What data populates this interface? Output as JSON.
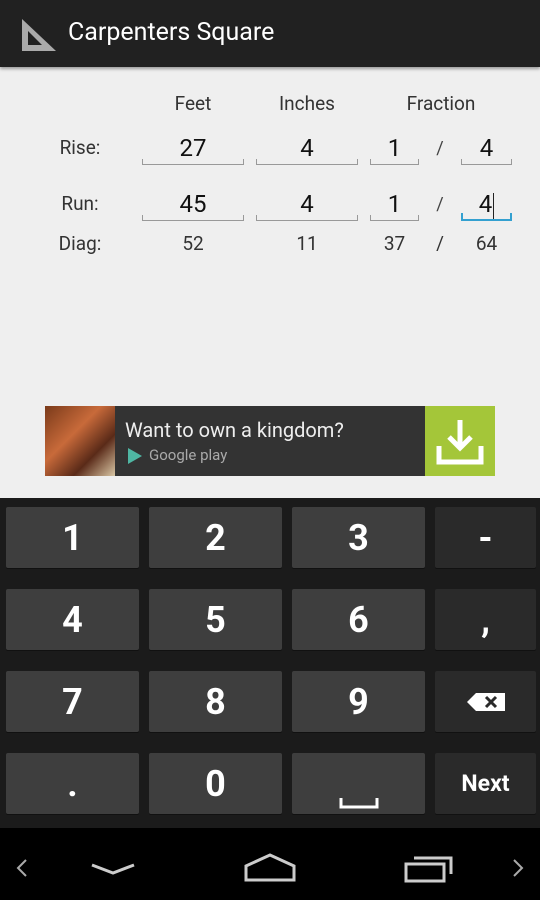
{
  "app": {
    "title": "Carpenters Square",
    "icon": "set-square-icon"
  },
  "columns": {
    "feet": "Feet",
    "inches": "Inches",
    "fraction": "Fraction"
  },
  "rows": {
    "rise": {
      "label": "Rise:",
      "feet": "27",
      "inches": "4",
      "num": "1",
      "den": "4"
    },
    "run": {
      "label": "Run:",
      "feet": "45",
      "inches": "4",
      "num": "1",
      "den": "4"
    },
    "diag": {
      "label": "Diag:",
      "feet": "52",
      "inches": "11",
      "num": "37",
      "den": "64"
    }
  },
  "slash": "/",
  "ad": {
    "text": "Want to own a kingdom?",
    "store": "Google play",
    "accent": "#a4c639"
  },
  "keyboard": {
    "keys": [
      "1",
      "2",
      "3",
      "-",
      "4",
      "5",
      "6",
      ",",
      "7",
      "8",
      "9",
      "⌫",
      ".",
      "0",
      "␣",
      "Next"
    ]
  },
  "colors": {
    "focus": "#33a0d0",
    "actionbar": "#212121"
  }
}
